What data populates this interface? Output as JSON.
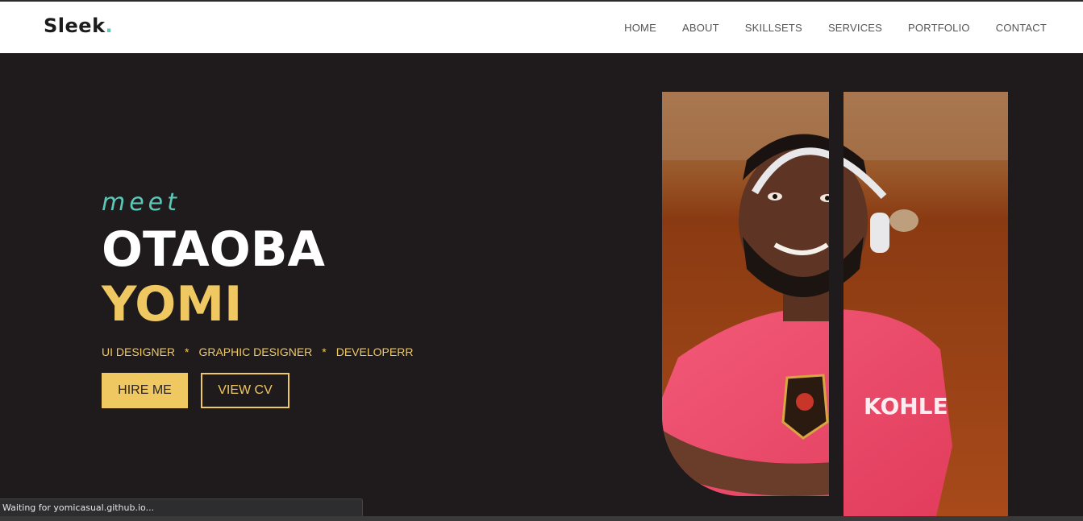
{
  "header": {
    "logo_text": "Sleek",
    "logo_dot": ".",
    "nav": [
      "HOME",
      "ABOUT",
      "SKILLSETS",
      "SERVICES",
      "PORTFOLIO",
      "CONTACT"
    ]
  },
  "hero": {
    "greeting": "meet",
    "first_name": "OTAOBA",
    "last_name": "YOMI",
    "roles": [
      "UI DESIGNER",
      "GRAPHIC DESIGNER",
      "DEVELOPERR"
    ],
    "role_separator": "*",
    "hire_button": "HIRE ME",
    "cv_button": "VIEW CV"
  },
  "browser": {
    "status_text": "Waiting for yomicasual.github.io..."
  },
  "colors": {
    "accent_teal": "#5cc7b8",
    "accent_gold": "#f0c862",
    "background": "#1f1b1c",
    "jersey_pink": "#ee4a6a"
  }
}
